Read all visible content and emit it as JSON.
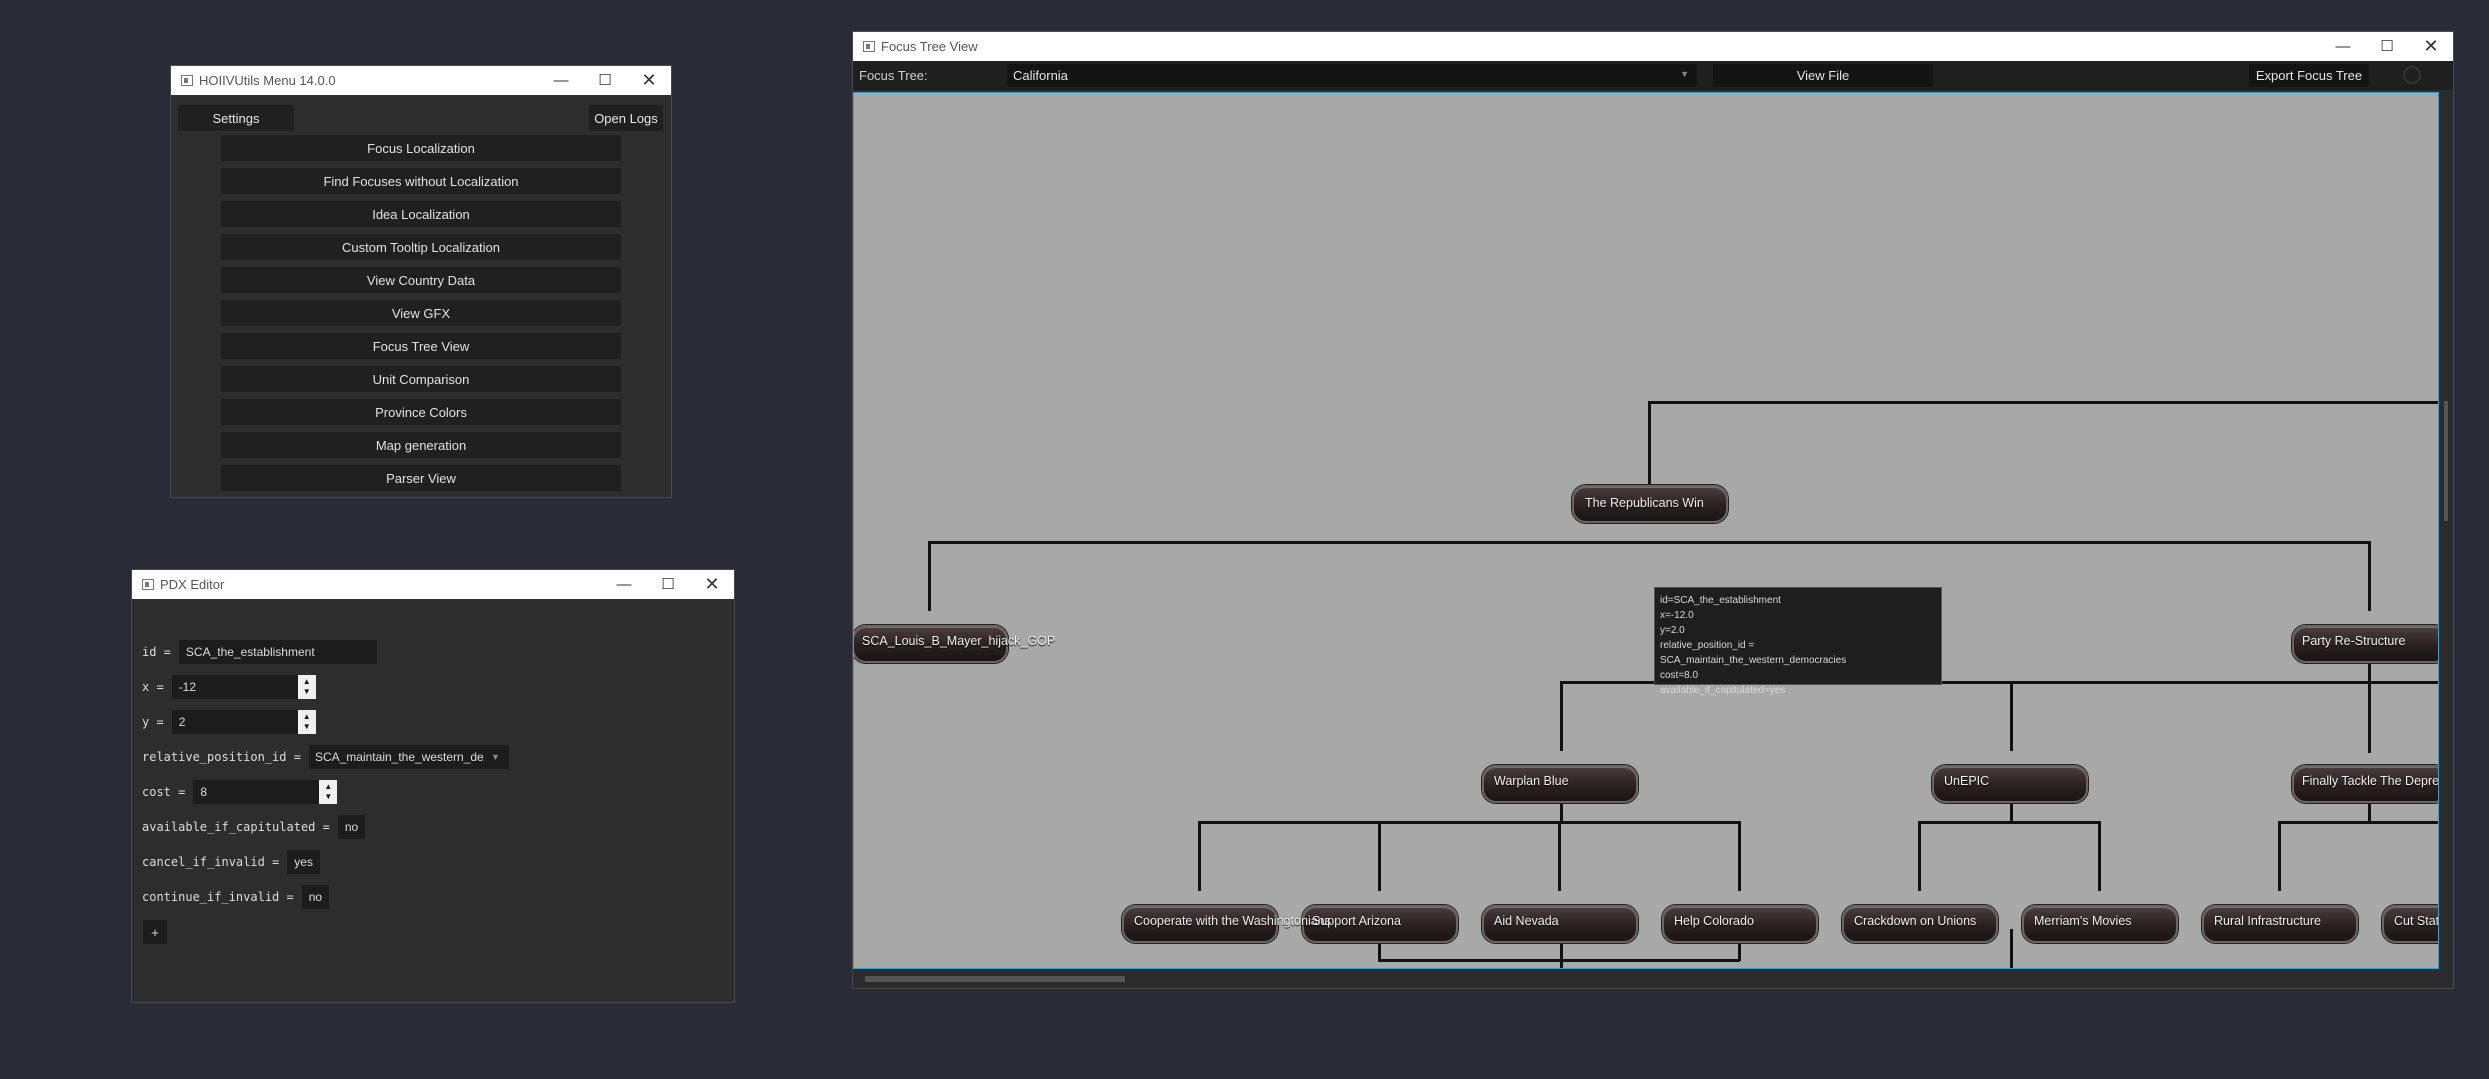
{
  "menu_window": {
    "title": "HOIIVUtils Menu 14.0.0",
    "settings_label": "Settings",
    "open_logs_label": "Open Logs",
    "buttons": [
      "Focus Localization",
      "Find Focuses without Localization",
      "Idea Localization",
      "Custom Tooltip Localization",
      "View Country Data",
      "View GFX",
      "Focus Tree View",
      "Unit Comparison",
      "Province Colors",
      "Map generation",
      "Parser View"
    ]
  },
  "pdx_editor": {
    "title": "PDX Editor",
    "fields": {
      "id": {
        "label": "id =",
        "value": "SCA_the_establishment"
      },
      "x": {
        "label": "x =",
        "value": "-12"
      },
      "y": {
        "label": "y =",
        "value": "2"
      },
      "relative_position_id": {
        "label": "relative_position_id =",
        "value": "SCA_maintain_the_western_de..."
      },
      "cost": {
        "label": "cost =",
        "value": "8"
      },
      "available_if_capitulated": {
        "label": "available_if_capitulated =",
        "value": "no"
      },
      "cancel_if_invalid": {
        "label": "cancel_if_invalid =",
        "value": "yes"
      },
      "continue_if_invalid": {
        "label": "continue_if_invalid =",
        "value": "no"
      }
    },
    "add_label": "+"
  },
  "focus_window": {
    "title": "Focus Tree View",
    "focus_tree_label": "Focus Tree:",
    "selected_tree": "California",
    "view_file_label": "View File",
    "export_label": "Export Focus Tree",
    "focuses": {
      "republicans_win": "The Republicans Win",
      "louis_mayer": "SCA_Louis_B_Mayer_hijack_GOP",
      "party_restructure": "Party Re-Structure",
      "warplan_blue": "Warplan Blue",
      "unepic": "UnEPIC",
      "finally_tackle": "Finally Tackle The Depression",
      "cooperate": "Cooperate with the Washingtonians",
      "support_arizona": "Support Arizona",
      "aid_nevada": "Aid Nevada",
      "help_colorado": "Help Colorado",
      "crackdown": "Crackdown on Unions",
      "merriams": "Merriam's Movies",
      "rural": "Rural Infrastructure",
      "cut_state": "Cut State"
    },
    "tooltip": [
      "id=SCA_the_establishment",
      "x=-12.0",
      "y=2.0",
      "relative_position_id = SCA_maintain_the_western_democracies",
      "cost=8.0",
      "available_if_capitulated=yes"
    ]
  }
}
